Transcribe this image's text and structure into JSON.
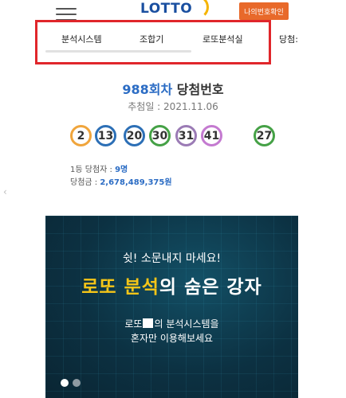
{
  "header": {
    "logo_text": "LOTTO",
    "my_number_button": "나의번호확인"
  },
  "nav": {
    "items": [
      "분석시스템",
      "조합기",
      "로또분석실",
      "당첨:"
    ]
  },
  "round": {
    "number": "988회차",
    "label": "당첨번호",
    "date_label": "추첨일 :",
    "date": "2021.11.06"
  },
  "balls": [
    {
      "value": "2",
      "color": "#f0a53c"
    },
    {
      "value": "13",
      "color": "#2c6fb6"
    },
    {
      "value": "20",
      "color": "#2c6fb6"
    },
    {
      "value": "30",
      "color": "#45a146"
    },
    {
      "value": "31",
      "color": "#9b7bb5"
    },
    {
      "value": "41",
      "color": "#c47ad0"
    }
  ],
  "bonus_ball": {
    "value": "27",
    "color": "#45a146"
  },
  "winners": {
    "first_label": "1등 당첨자 :",
    "first_value": "9명",
    "prize_label": "당첨금 :",
    "prize_value": "2,678,489,375원"
  },
  "banner": {
    "subtitle": "쉿! 소문내지 마세요!",
    "headline_highlight": "로또 분석",
    "headline_rest": "의 숨은 강자",
    "desc1_prefix": "로또",
    "desc1_suffix": "의 분석시스템을",
    "desc2": "혼자만 이용해보세요"
  },
  "colors": {
    "accent_blue": "#2b6cc4",
    "nav_highlight_border": "#e0262b",
    "button_orange": "#e8692a",
    "banner_yellow": "#f5c518"
  },
  "carousel": {
    "total_dots": 2,
    "active_index": 1
  }
}
